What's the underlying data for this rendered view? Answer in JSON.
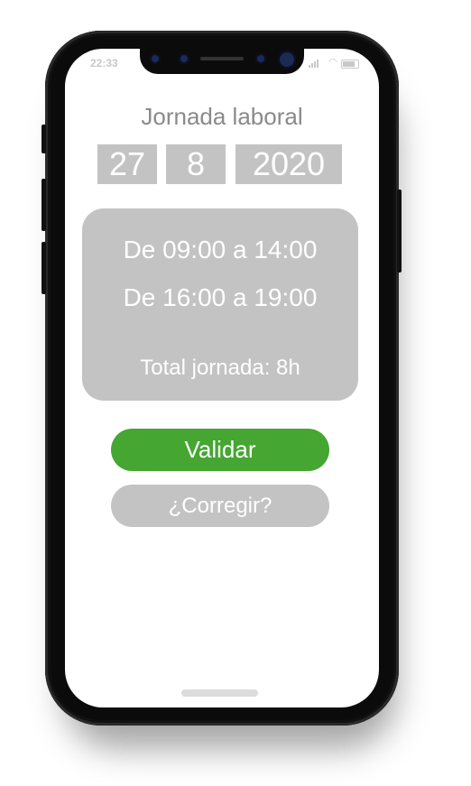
{
  "status_bar": {
    "time": "22:33"
  },
  "app": {
    "title": "Jornada laboral",
    "date": {
      "day": "27",
      "month": "8",
      "year": "2020"
    },
    "schedule": {
      "slots": [
        "De 09:00 a 14:00",
        "De 16:00 a 19:00"
      ],
      "total": "Total jornada: 8h"
    },
    "buttons": {
      "validate": "Validar",
      "correct": "¿Corregir?"
    }
  },
  "colors": {
    "accent_green": "#45a632",
    "panel_gray": "#c3c3c3",
    "title_gray": "#8a8a8a"
  },
  "icons": [
    "signal-icon",
    "wifi-icon",
    "battery-icon"
  ]
}
